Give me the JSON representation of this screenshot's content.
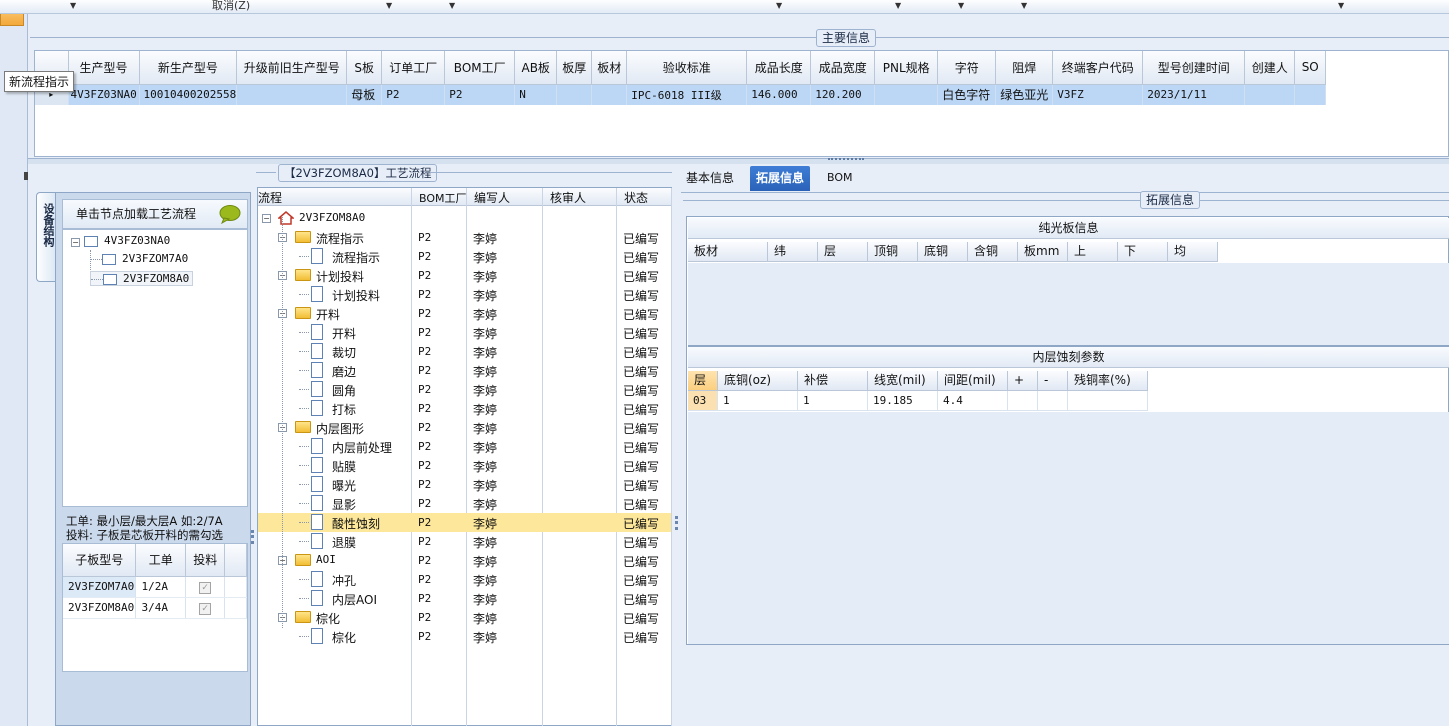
{
  "toolbar": {
    "cancel_label": "取消(Z)"
  },
  "tooltip": "新流程指示",
  "main_info": {
    "title": "主要信息",
    "columns": [
      "生产型号",
      "新生产型号",
      "升级前旧生产型号",
      "S板",
      "订单工厂",
      "BOM工厂",
      "AB板",
      "板厚",
      "板材",
      "验收标准",
      "成品长度",
      "成品宽度",
      "PNL规格",
      "字符",
      "阻焊",
      "终端客户代码",
      "型号创建时间",
      "创建人",
      "SO"
    ],
    "row": {
      "row_marker": "▸",
      "model": "4V3FZ03NA0",
      "new_model": "10010400202558",
      "old_model": "",
      "s_board": "母板",
      "order_factory": "P2",
      "bom_factory": "P2",
      "ab_board": "N",
      "thickness": "",
      "material": "",
      "standard": "IPC-6018 III级",
      "length": "146.000",
      "width": "120.200",
      "pnl": "",
      "character": "白色字符",
      "solder_mask": "绿色亚光",
      "customer_code": "V3FZ",
      "created": "2023/1/11",
      "creator": "",
      "so": ""
    }
  },
  "side_tab": "设备结构",
  "left_panel": {
    "header": "单击节点加载工艺流程",
    "tree": {
      "root": "4V3FZ03NA0",
      "children": [
        "2V3FZOM7A0",
        "2V3FZOM8A0"
      ]
    },
    "note_line1": "工单: 最小层/最大层A 如:2/7A",
    "note_line2": "投料: 子板是芯板开料的需勾选",
    "sub_columns": [
      "子板型号",
      "工单",
      "投料"
    ],
    "sub_rows": [
      {
        "model": "2V3FZOM7A0",
        "work": "1/2A",
        "feed": "✓"
      },
      {
        "model": "2V3FZOM8A0",
        "work": "3/4A",
        "feed": "✓"
      }
    ]
  },
  "process": {
    "title": "【2V3FZOM8A0】工艺流程",
    "columns": [
      "流程",
      "BOM工厂",
      "编写人",
      "核审人",
      "状态"
    ],
    "root": "2V3FZOM8A0",
    "rows": [
      {
        "name": "流程指示",
        "factory": "P2",
        "editor": "李婷",
        "status": "已编写"
      },
      {
        "name": "流程指示",
        "factory": "P2",
        "editor": "李婷",
        "status": "已编写"
      },
      {
        "name": "计划投料",
        "factory": "P2",
        "editor": "李婷",
        "status": "已编写"
      },
      {
        "name": "计划投料",
        "factory": "P2",
        "editor": "李婷",
        "status": "已编写"
      },
      {
        "name": "开料",
        "factory": "P2",
        "editor": "李婷",
        "status": "已编写"
      },
      {
        "name": "开料",
        "factory": "P2",
        "editor": "李婷",
        "status": "已编写"
      },
      {
        "name": "裁切",
        "factory": "P2",
        "editor": "李婷",
        "status": "已编写"
      },
      {
        "name": "磨边",
        "factory": "P2",
        "editor": "李婷",
        "status": "已编写"
      },
      {
        "name": "圆角",
        "factory": "P2",
        "editor": "李婷",
        "status": "已编写"
      },
      {
        "name": "打标",
        "factory": "P2",
        "editor": "李婷",
        "status": "已编写"
      },
      {
        "name": "内层图形",
        "factory": "P2",
        "editor": "李婷",
        "status": "已编写"
      },
      {
        "name": "内层前处理",
        "factory": "P2",
        "editor": "李婷",
        "status": "已编写"
      },
      {
        "name": "贴膜",
        "factory": "P2",
        "editor": "李婷",
        "status": "已编写"
      },
      {
        "name": "曝光",
        "factory": "P2",
        "editor": "李婷",
        "status": "已编写"
      },
      {
        "name": "显影",
        "factory": "P2",
        "editor": "李婷",
        "status": "已编写"
      },
      {
        "name": "酸性蚀刻",
        "factory": "P2",
        "editor": "李婷",
        "status": "已编写"
      },
      {
        "name": "退膜",
        "factory": "P2",
        "editor": "李婷",
        "status": "已编写"
      },
      {
        "name": "AOI",
        "factory": "P2",
        "editor": "李婷",
        "status": "已编写"
      },
      {
        "name": "冲孔",
        "factory": "P2",
        "editor": "李婷",
        "status": "已编写"
      },
      {
        "name": "内层AOI",
        "factory": "P2",
        "editor": "李婷",
        "status": "已编写"
      },
      {
        "name": "棕化",
        "factory": "P2",
        "editor": "李婷",
        "status": "已编写"
      },
      {
        "name": "棕化",
        "factory": "P2",
        "editor": "李婷",
        "status": "已编写"
      }
    ]
  },
  "right_tabs": [
    "基本信息",
    "拓展信息",
    "BOM"
  ],
  "ext": {
    "title": "拓展信息",
    "laminate_title": "纯光板信息",
    "laminate_columns": [
      "板材",
      "纬",
      "层",
      "顶铜",
      "底铜",
      "含铜",
      "板mm",
      "上",
      "下",
      "均"
    ],
    "etch_title": "内层蚀刻参数",
    "etch_columns": [
      "层",
      "底铜(oz)",
      "补偿",
      "线宽(mil)",
      "间距(mil)",
      "+",
      "-",
      "残铜率(%)"
    ],
    "etch_row": {
      "layer": "03",
      "base_cu": "1",
      "comp": "1",
      "line_w": "19.185",
      "space": "4.4",
      "plus": "",
      "minus": "",
      "residual": ""
    }
  }
}
